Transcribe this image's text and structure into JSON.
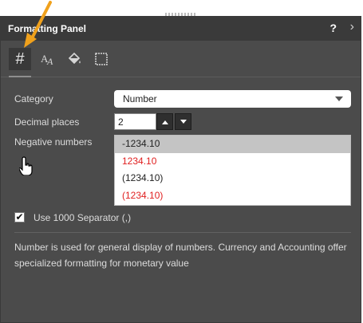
{
  "panel": {
    "title": "Formatting Panel",
    "help_icon": "?",
    "collapse_icon": "›",
    "toolbar": [
      {
        "name": "number-format-icon",
        "glyph": "#",
        "active": true
      },
      {
        "name": "text-format-icon",
        "glyph": "A",
        "active": false
      },
      {
        "name": "fill-color-icon",
        "glyph": "paint-bucket",
        "active": false
      },
      {
        "name": "border-icon",
        "glyph": "square",
        "active": false
      }
    ]
  },
  "form": {
    "category_label": "Category",
    "category_value": "Number",
    "decimal_label": "Decimal places",
    "decimal_value": "2",
    "negative_label": "Negative numbers",
    "negative_options": [
      {
        "text": "-1234.10",
        "color": "#222222",
        "selected": true
      },
      {
        "text": "1234.10",
        "color": "#e02020",
        "selected": false
      },
      {
        "text": "(1234.10)",
        "color": "#222222",
        "selected": false
      },
      {
        "text": "(1234.10)",
        "color": "#e02020",
        "selected": false
      }
    ],
    "separator_label": "Use 1000 Separator (,)",
    "separator_checked": true,
    "description": "Number is used for general display of numbers. Currency and Accounting offer specialized formatting for monetary value"
  },
  "colors": {
    "panel_bg": "#4b4b4b",
    "titlebar_bg": "#3a3a3a",
    "accent_arrow": "#f0a11c"
  }
}
